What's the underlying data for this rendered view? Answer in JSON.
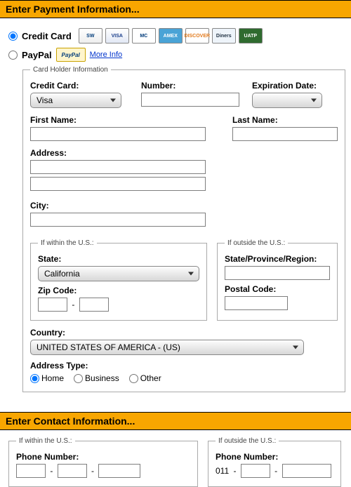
{
  "payment": {
    "header": "Enter Payment Information...",
    "cc_label": "Credit Card",
    "paypal_label": "PayPal",
    "more_info": "More Info",
    "badges": {
      "sw": "SW",
      "visa": "VISA",
      "mc": "MC",
      "amex": "AMEX",
      "disc": "DISCOVER",
      "diners": "Diners",
      "uatp": "UATP",
      "paypal": "PayPal"
    },
    "cardholder_legend": "Card Holder Information",
    "credit_card_label": "Credit Card:",
    "credit_card_value": "Visa",
    "number_label": "Number:",
    "number_value": "",
    "exp_label": "Expiration Date:",
    "exp_value": "",
    "first_name_label": "First Name:",
    "first_name_value": "",
    "last_name_label": "Last Name:",
    "last_name_value": "",
    "address_label": "Address:",
    "address1_value": "",
    "address2_value": "",
    "city_label": "City:",
    "city_value": "",
    "us_legend": "If within the U.S.:",
    "state_label": "State:",
    "state_value": "California",
    "zip_label": "Zip Code:",
    "zip1_value": "",
    "zip2_value": "",
    "intl_legend": "If outside the U.S.:",
    "region_label": "State/Province/Region:",
    "region_value": "",
    "postal_label": "Postal Code:",
    "postal_value": "",
    "country_label": "Country:",
    "country_value": "UNITED STATES OF AMERICA - (US)",
    "addr_type_label": "Address Type:",
    "addr_type_home": "Home",
    "addr_type_business": "Business",
    "addr_type_other": "Other"
  },
  "contact": {
    "header": "Enter Contact Information...",
    "us_legend": "If within the U.S.:",
    "phone_label": "Phone Number:",
    "p1": "",
    "p2": "",
    "p3": "",
    "intl_legend": "If outside the U.S.:",
    "intl_phone_label": "Phone Number:",
    "intl_prefix": "011",
    "ip1": "",
    "ip2": ""
  }
}
